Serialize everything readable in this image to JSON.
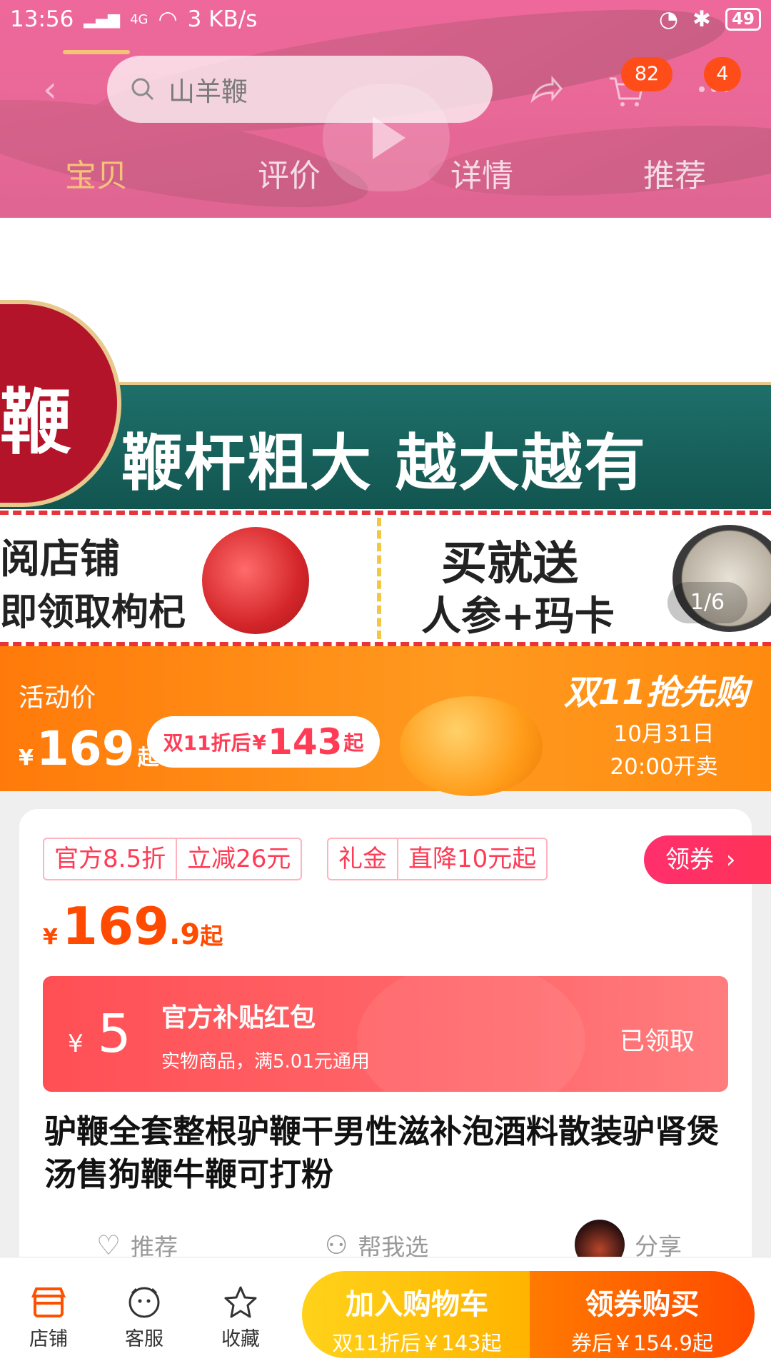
{
  "status_bar": {
    "time": "13:56",
    "network": "4G",
    "speed": "3 KB/s",
    "battery": "49"
  },
  "header": {
    "search_placeholder": "山羊鞭",
    "cart_badge": "82",
    "more_badge": "4",
    "tabs": [
      {
        "label": "宝贝",
        "active": true
      },
      {
        "label": "评价",
        "active": false
      },
      {
        "label": "详情",
        "active": false
      },
      {
        "label": "推荐",
        "active": false
      }
    ]
  },
  "banner": {
    "red_char": "鞭",
    "slogan": "鞭杆粗大  越大越有",
    "left_line1": "阅店铺",
    "left_line2": "即领取枸杞",
    "right_line1": "买就送",
    "right_line2": "人参+玛卡",
    "page_indicator": "1/6"
  },
  "promo": {
    "label": "活动价",
    "currency": "¥",
    "price": "169",
    "price_suffix": "起",
    "pill_text": "双11折后",
    "pill_currency": "¥",
    "pill_price": "143",
    "pill_suffix": "起",
    "event": "双11抢先购",
    "date": "10月31日",
    "time": "20:00开卖"
  },
  "info": {
    "tags_1": [
      "官方8.5折",
      "立减26元"
    ],
    "tags_2": [
      "礼金",
      "直降10元起"
    ],
    "coupon_button": "领券",
    "currency": "¥",
    "price_int": "169",
    "price_dec": ".9",
    "price_suffix": "起",
    "red_packet": {
      "currency": "¥",
      "amount": "5",
      "title": "官方补贴红包",
      "desc": "实物商品，满5.01元通用",
      "status": "已领取"
    },
    "product_title": "驴鞭全套整根驴鞭干男性滋补泡酒料散装驴肾煲汤售狗鞭牛鞭可打粉",
    "actions": {
      "recommend": "推荐",
      "help_choose": "帮我选",
      "share": "分享"
    }
  },
  "bottom_bar": {
    "shop": "店铺",
    "service": "客服",
    "favorite": "收藏",
    "add_cart": "加入购物车",
    "add_cart_sub": "双11折后￥143起",
    "buy": "领券购买",
    "buy_sub": "券后￥154.9起"
  },
  "colors": {
    "accent_orange": "#ff5000",
    "accent_pink": "#ff3b55",
    "tab_active": "#f5c27a"
  }
}
